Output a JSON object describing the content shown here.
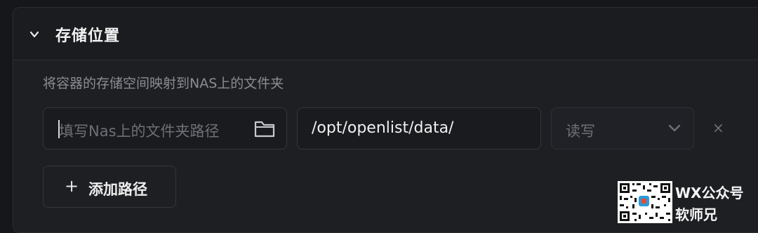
{
  "section": {
    "title": "存储位置",
    "description": "将容器的存储空间映射到NAS上的文件夹"
  },
  "mapping": {
    "host_path_placeholder": "填写Nas上的文件夹路径",
    "host_path_value": "",
    "container_path": "/opt/openlist/data/",
    "mode": "读写",
    "remove_label": "×"
  },
  "add_button": {
    "icon": "+",
    "label": "添加路径"
  },
  "icons": {
    "collapse": "chevron-down-icon",
    "browse": "folder-icon",
    "mode_dropdown": "chevron-down-icon",
    "remove": "close-icon"
  },
  "watermark": {
    "line1": "WX公众号",
    "line2": "软师兄"
  }
}
